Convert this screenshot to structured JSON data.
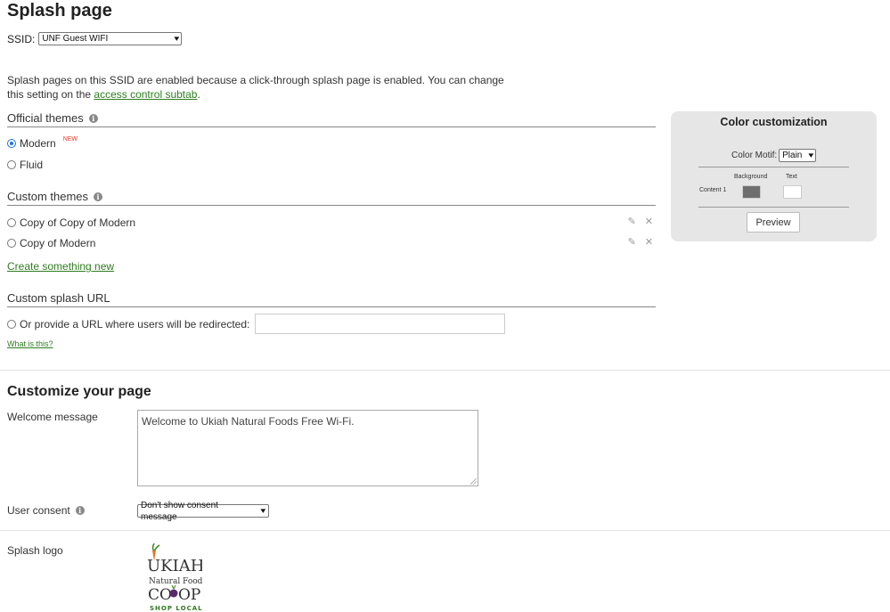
{
  "page": {
    "title": "Splash page"
  },
  "ssid": {
    "label": "SSID:",
    "selected": "UNF Guest WIFI"
  },
  "notice": {
    "text": "Splash pages on this SSID are enabled because a click-through splash page is enabled. You can change this setting on the ",
    "link": "access control subtab",
    "end": "."
  },
  "official_themes": {
    "title": "Official themes",
    "options": [
      {
        "label": "Modern",
        "badge": "NEW",
        "checked": true
      },
      {
        "label": "Fluid",
        "checked": false
      }
    ]
  },
  "custom_themes": {
    "title": "Custom themes",
    "options": [
      {
        "label": "Copy of Copy of Modern",
        "checked": false
      },
      {
        "label": "Copy of Modern",
        "checked": false
      }
    ],
    "create_link": "Create something new"
  },
  "custom_url": {
    "title": "Custom splash URL",
    "option_label": "Or provide a URL where users will be redirected:",
    "input_value": "",
    "help_link": "What is this?"
  },
  "customize": {
    "title": "Customize your page",
    "welcome": {
      "label": "Welcome message",
      "value": "Welcome to Ukiah Natural Foods Free Wi-Fi."
    },
    "consent": {
      "label": "User consent",
      "selected": "Don't show consent message"
    },
    "logo": {
      "label": "Splash logo",
      "lines": [
        "UKIAH",
        "Natural Foods",
        "CO",
        "OP",
        "SHOP LOCAL"
      ]
    }
  },
  "color_panel": {
    "title": "Color customization",
    "motif_label": "Color Motif:",
    "motif_selected": "Plain",
    "col_background": "Background",
    "col_text": "Text",
    "row_label": "Content 1",
    "background_color": "#6e6e6e",
    "text_color": "#ffffff",
    "preview_label": "Preview"
  },
  "colors": {
    "link": "#2e7d1f",
    "radio_accent": "#1a73e8",
    "badge": "#e0402a"
  }
}
